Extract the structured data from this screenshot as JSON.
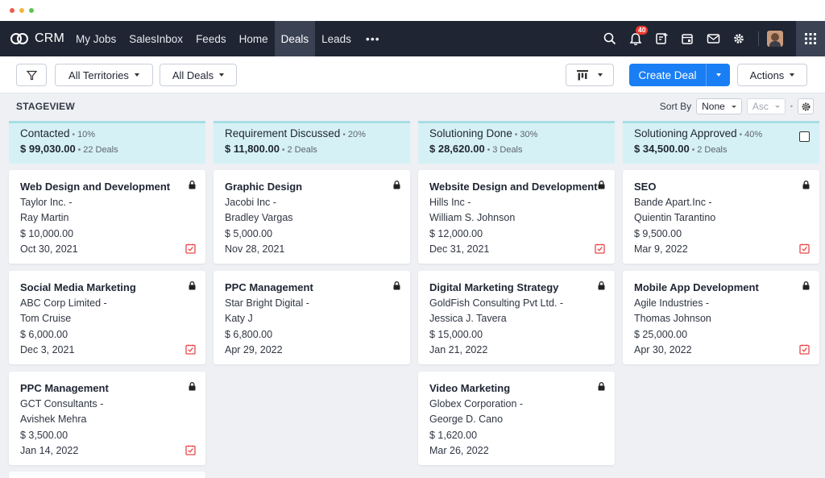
{
  "app": {
    "name": "CRM"
  },
  "nav": {
    "items": [
      "My Jobs",
      "SalesInbox",
      "Feeds",
      "Home",
      "Deals",
      "Leads"
    ],
    "active": "Deals",
    "more": "•••",
    "notification_count": "40"
  },
  "toolbar": {
    "filter_icon": "filter-icon",
    "territories": "All Territories",
    "deals_filter": "All Deals",
    "create_deal": "Create Deal",
    "actions": "Actions"
  },
  "board": {
    "view_label": "STAGEVIEW",
    "sort_by_label": "Sort By",
    "sort_by_value": "None",
    "sort_order": "Asc"
  },
  "stages": [
    {
      "name": "Contacted",
      "percent": "10%",
      "amount": "$ 99,030.00",
      "count": "22 Deals",
      "cards": [
        {
          "title": "Web Design and Development",
          "company": "Taylor Inc.  -",
          "contact": "Ray Martin",
          "amount": "$ 10,000.00",
          "date": "Oct 30, 2021",
          "task": true
        },
        {
          "title": "Social Media Marketing",
          "company": "ABC Corp Limited  -",
          "contact": "Tom Cruise",
          "amount": "$ 6,000.00",
          "date": "Dec 3, 2021",
          "task": true
        },
        {
          "title": "PPC Management",
          "company": "GCT Consultants  -",
          "contact": "Avishek Mehra",
          "amount": "$ 3,500.00",
          "date": "Jan 14, 2022",
          "task": true
        }
      ]
    },
    {
      "name": "Requirement Discussed",
      "percent": "20%",
      "amount": "$ 11,800.00",
      "count": "2 Deals",
      "cards": [
        {
          "title": "Graphic Design",
          "company": "Jacobi Inc  -",
          "contact": "Bradley Vargas",
          "amount": "$ 5,000.00",
          "date": "Nov 28, 2021",
          "task": false
        },
        {
          "title": "PPC Management",
          "company": "Star Bright Digital  -",
          "contact": "Katy J",
          "amount": "$ 6,800.00",
          "date": "Apr 29, 2022",
          "task": false
        }
      ]
    },
    {
      "name": "Solutioning Done",
      "percent": "30%",
      "amount": "$ 28,620.00",
      "count": "3 Deals",
      "cards": [
        {
          "title": "Website Design and Development",
          "company": "Hills Inc  -",
          "contact": "William S. Johnson",
          "amount": "$ 12,000.00",
          "date": "Dec 31, 2021",
          "task": true
        },
        {
          "title": "Digital Marketing Strategy",
          "company": "GoldFish Consulting Pvt Ltd.  -",
          "contact": "Jessica J. Tavera",
          "amount": "$ 15,000.00",
          "date": "Jan 21, 2022",
          "task": false
        },
        {
          "title": "Video Marketing",
          "company": "Globex Corporation  -",
          "contact": "George D. Cano",
          "amount": "$ 1,620.00",
          "date": "Mar 26, 2022",
          "task": false
        }
      ]
    },
    {
      "name": "Solutioning Approved",
      "percent": "40%",
      "amount": "$ 34,500.00",
      "count": "2 Deals",
      "cards": [
        {
          "title": "SEO",
          "company": "Bande Apart.Inc  -",
          "contact": "Quientin Tarantino",
          "amount": "$ 9,500.00",
          "date": "Mar 9, 2022",
          "task": true
        },
        {
          "title": "Mobile App Development",
          "company": "Agile Industries  -",
          "contact": "Thomas Johnson",
          "amount": "$ 25,000.00",
          "date": "Apr 30, 2022",
          "task": true
        }
      ]
    }
  ],
  "colors": {
    "nav_bg": "#1f2532",
    "accent": "#1a7ef4",
    "stage_header_bg": "#d6f1f5",
    "board_bg": "#eef0f4",
    "task_icon": "#e8474a",
    "badge": "#e9382f"
  },
  "icons": {
    "logo": "crm-logo-icon",
    "search": "search-icon",
    "notifications": "bell-icon",
    "add_note": "add-note-icon",
    "calendar": "calendar-icon",
    "mail": "mail-icon",
    "settings": "gear-icon",
    "apps": "apps-grid-icon",
    "lock": "lock-icon",
    "task": "task-due-icon"
  }
}
